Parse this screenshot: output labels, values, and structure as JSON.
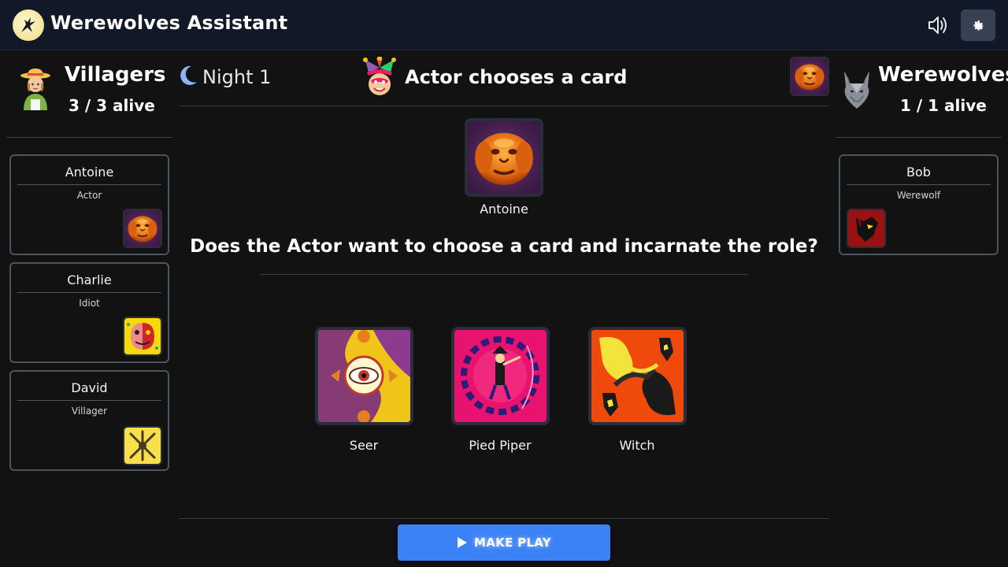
{
  "header": {
    "title": "Werewolves Assistant",
    "logo_icon": "howling-wolf-logo",
    "sound_icon": "speaker-icon",
    "settings_icon": "gear-icon",
    "bg_color": "#111827",
    "settings_bg_color": "#374151"
  },
  "villagers": {
    "name": "Villagers",
    "alive": "3 / 3 alive",
    "icon": "farmer-icon",
    "players": [
      {
        "name": "Antoine",
        "role": "Actor",
        "card_icon": "actor-card-icon"
      },
      {
        "name": "Charlie",
        "role": "Idiot",
        "card_icon": "idiot-card-icon"
      },
      {
        "name": "David",
        "role": "Villager",
        "card_icon": "villager-card-icon"
      }
    ]
  },
  "werewolves": {
    "name": "Werewolves",
    "alive": "1 / 1 alive",
    "icon": "wolf-icon",
    "players": [
      {
        "name": "Bob",
        "role": "Werewolf",
        "card_icon": "werewolf-card-icon"
      }
    ]
  },
  "game": {
    "phase": "Night 1",
    "phase_icon": "moon-icon",
    "step_title": "Actor chooses a card",
    "step_icon": "jester-mask-icon",
    "target_player": "Antoine",
    "question": "Does the Actor want to choose a card and incarnate the role?",
    "cards": [
      {
        "label": "Seer",
        "icon": "seer-card-icon"
      },
      {
        "label": "Pied Piper",
        "icon": "pied-piper-card-icon"
      },
      {
        "label": "Witch",
        "icon": "witch-card-icon"
      }
    ],
    "play_button": "MAKE PLAY",
    "play_icon": "play-icon",
    "accent_color": "#3b82f6"
  }
}
